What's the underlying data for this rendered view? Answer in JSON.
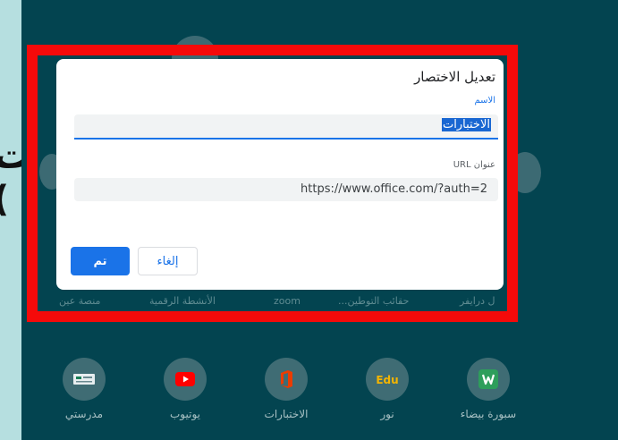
{
  "overlay_text": {
    "line1": "ت",
    "line2": "("
  },
  "background_shortcuts_row1": [
    {
      "label": "منصة عين"
    },
    {
      "label": "الأنشطة الرقمية"
    },
    {
      "label": "zoom"
    },
    {
      "label": "حقائب التوطين..."
    },
    {
      "label": "ل درايفر"
    }
  ],
  "background_shortcuts_row2": [
    {
      "label": "مدرستي",
      "icon": "madrasati-logo-icon",
      "color": "#ffffff"
    },
    {
      "label": "يوتيوب",
      "icon": "youtube-icon",
      "color": "#ff0000"
    },
    {
      "label": "الاختبارات",
      "icon": "office-icon",
      "color": "#eb3c00"
    },
    {
      "label": "نور",
      "icon": "edu-icon",
      "color": "#f4b400"
    },
    {
      "label": "سبورة بيضاء",
      "icon": "whiteboard-icon",
      "color": "#2e9e5b"
    }
  ],
  "dialog": {
    "title": "تعديل الاختصار",
    "name_label": "الاسم",
    "name_value": "الاختبارات",
    "url_label": "عنوان URL",
    "url_value": "https://www.office.com/?auth=2",
    "cancel_label": "إلغاء",
    "done_label": "تم"
  },
  "colors": {
    "screen_bg": "#034450",
    "highlight_frame": "#f50a0a",
    "accent": "#1a73e8"
  }
}
